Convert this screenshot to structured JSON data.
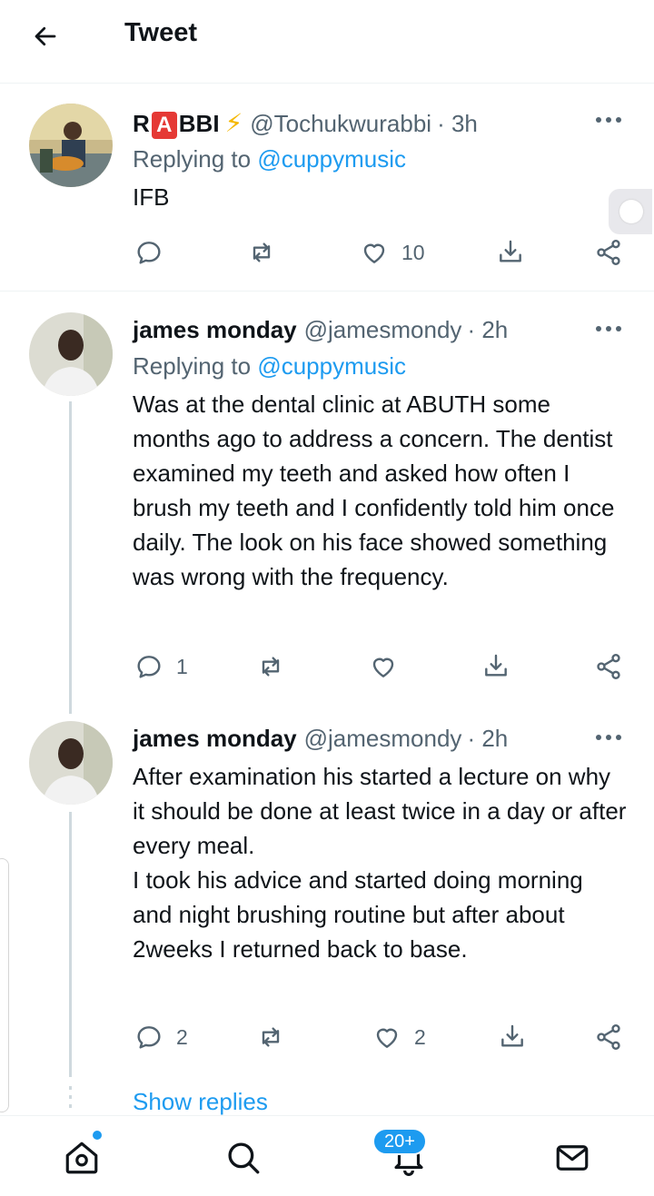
{
  "header": {
    "title": "Tweet",
    "back_icon": "arrow-left-icon"
  },
  "tweets": [
    {
      "name_prefix": "R",
      "name_badge": "A",
      "name_suffix": "BBI",
      "name_emoji": "⚡",
      "handle": "@Tochukwurabbi",
      "time": "· 3h",
      "replying_to_label": "Replying to",
      "replying_to": "@cuppymusic",
      "text": "IFB",
      "replies": "",
      "retweets": "",
      "likes": "10"
    },
    {
      "name": "james monday",
      "handle": "@jamesmondy",
      "time": "· 2h",
      "replying_to_label": "Replying to",
      "replying_to": "@cuppymusic",
      "text": "Was at the dental clinic at ABUTH some months ago to address a concern. The dentist examined my teeth and asked how often I brush my teeth and I confidently told him once daily. The look on his face showed something was wrong with the frequency.",
      "replies": "1",
      "retweets": "",
      "likes": ""
    },
    {
      "name": "james monday",
      "handle": "@jamesmondy",
      "time": "· 2h",
      "text": "After examination his started a lecture on why it should be done at least twice in a day or after every meal.\nI took his advice and started doing morning and night brushing routine but after about 2weeks I returned back to base.",
      "replies": "2",
      "retweets": "",
      "likes": "2"
    }
  ],
  "show_replies": "Show replies",
  "nav": {
    "items": [
      "home-icon",
      "search-icon",
      "notifications-icon",
      "messages-icon"
    ],
    "notifications_badge": "20+"
  },
  "colors": {
    "accent": "#1d9bf0",
    "secondary_text": "#536471",
    "badge_red": "#e53935",
    "bolt": "#f5b700"
  }
}
